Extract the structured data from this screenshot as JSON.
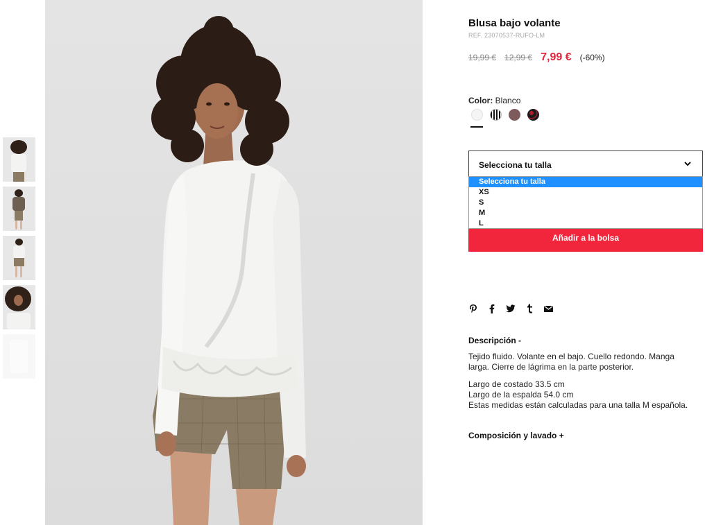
{
  "product": {
    "title": "Blusa bajo volante",
    "ref": "REF. 23070537-RUFO-LM",
    "price_original": "19,99 €",
    "price_previous": "12,99 €",
    "price_current": "7,99 €",
    "discount": "(-60%)"
  },
  "color": {
    "label": "Color:",
    "value": "Blanco",
    "swatches": [
      "white",
      "black-stripe",
      "mauve",
      "dark-print"
    ]
  },
  "size": {
    "placeholder": "Selecciona tu talla",
    "options": [
      "Selecciona tu talla",
      "XS",
      "S",
      "M",
      "L"
    ],
    "selected_index": 0
  },
  "add_to_bag": "Añadir a la bolsa",
  "share_icons": [
    "pinterest-icon",
    "facebook-icon",
    "twitter-icon",
    "tumblr-icon",
    "email-icon"
  ],
  "description": {
    "heading": "Descripción -",
    "text": "Tejido fluido. Volante en el bajo. Cuello redondo. Manga larga. Cierre de lágrima en la parte posterior.",
    "measure_1": "Largo de costado 33.5 cm",
    "measure_2": "Largo de la espalda 54.0 cm",
    "measure_3": "Estas medidas están calculadas para una talla M española."
  },
  "composition_heading": "Composición y lavado +",
  "colors": {
    "accent": "#f1263c",
    "price": "#e0263d",
    "selected_option": "#1e90ff"
  }
}
